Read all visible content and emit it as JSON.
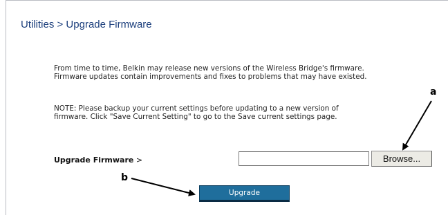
{
  "header": {
    "title": "Utilities > Upgrade Firmware"
  },
  "main": {
    "intro_text": "From time to time, Belkin may release new versions of the Wireless Bridge's firmware. Firmware updates contain improvements and fixes to problems that may have existed.",
    "note_text": "NOTE: Please backup your current settings before updating to a new version of firmware. Click \"Save Current Setting\" to go to the Save current settings page.",
    "upgrade_label_bold": "Upgrade Firmware",
    "upgrade_label_suffix": " >",
    "file_input_value": "",
    "browse_label": "Browse...",
    "upgrade_button_label": "Upgrade"
  },
  "callouts": {
    "a": "a",
    "b": "b"
  },
  "colors": {
    "title": "#1b3e7c",
    "upgrade_button": "#1f6e9c"
  }
}
